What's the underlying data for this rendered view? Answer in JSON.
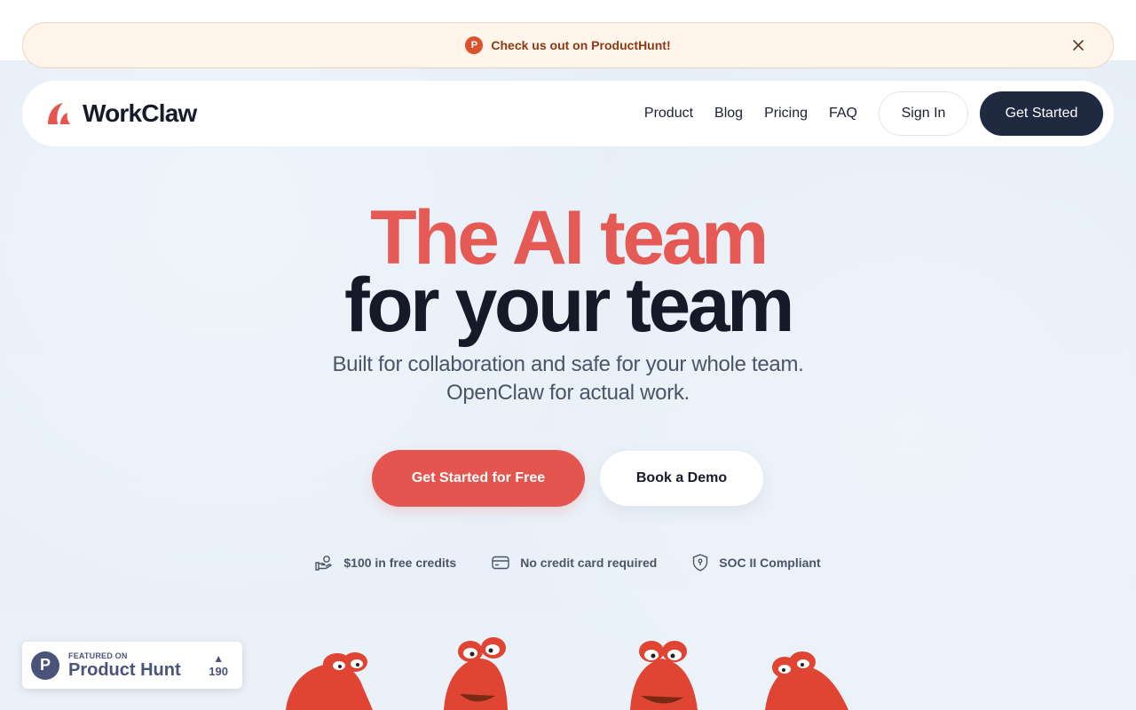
{
  "banner": {
    "icon_letter": "P",
    "text": "Check us out on ProductHunt!",
    "close_icon": "close-icon"
  },
  "nav": {
    "brand": "WorkClaw",
    "links": [
      "Product",
      "Blog",
      "Pricing",
      "FAQ"
    ],
    "signin_label": "Sign In",
    "get_started_label": "Get Started"
  },
  "hero": {
    "title_line1": "The AI team",
    "title_line2": "for your team",
    "subtitle_line1": "Built for collaboration and safe for your whole team.",
    "subtitle_line2": "OpenClaw for actual work.",
    "cta_primary": "Get Started for Free",
    "cta_secondary": "Book a Demo"
  },
  "features": [
    {
      "icon": "hand-coins-icon",
      "label": "$100 in free credits"
    },
    {
      "icon": "credit-card-icon",
      "label": "No credit card required"
    },
    {
      "icon": "shield-icon",
      "label": "SOC II Compliant"
    }
  ],
  "product_hunt_badge": {
    "logo_letter": "P",
    "small": "FEATURED ON",
    "big": "Product Hunt",
    "arrow": "▲",
    "votes": "190"
  },
  "colors": {
    "accent": "#e5554f",
    "dark": "#1f2940",
    "banner_bg": "#fff5ea",
    "page_bg": "#e9f0f8"
  }
}
